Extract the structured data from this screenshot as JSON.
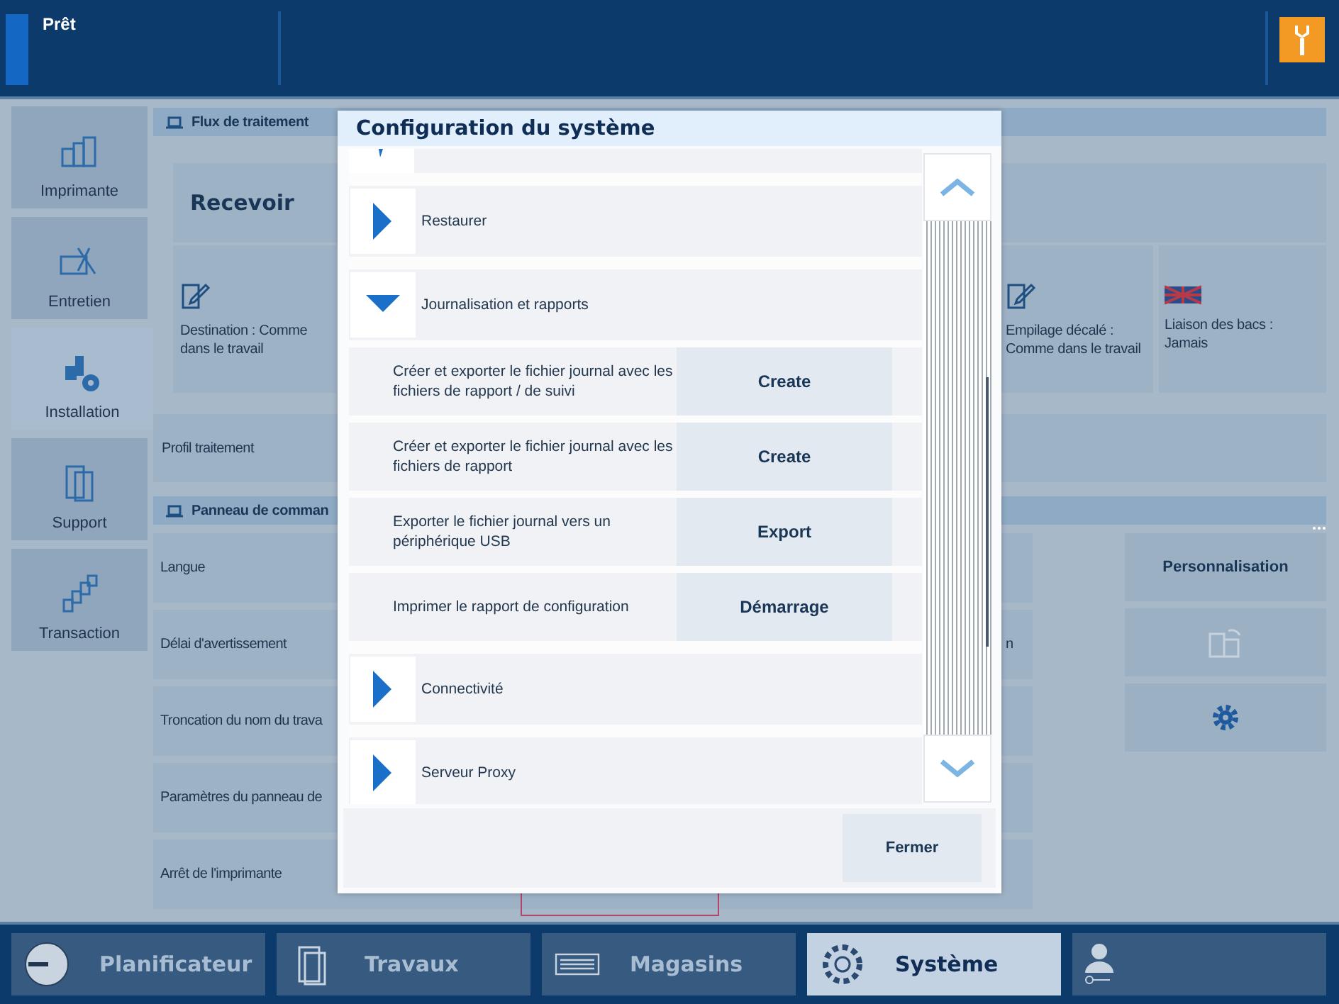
{
  "status_bar": {
    "text": "Prêt"
  },
  "sidebar": {
    "items": [
      {
        "label": "Imprimante",
        "kind": "printer",
        "selected": false
      },
      {
        "label": "Entretien",
        "kind": "tools",
        "selected": false
      },
      {
        "label": "Installation",
        "kind": "install",
        "selected": true
      },
      {
        "label": "Support",
        "kind": "support",
        "selected": false
      },
      {
        "label": "Transaction",
        "kind": "stairs",
        "selected": false
      }
    ]
  },
  "workflow": {
    "section_title": "Flux de traitement",
    "receive_title": "Recevoir",
    "settings": [
      {
        "label": "Destination : Comme dans le travail",
        "kind": "edit"
      },
      {
        "label": "Empilage décalé : Comme dans le travail",
        "kind": "edit"
      },
      {
        "label": "Liaison des bacs : Jamais",
        "kind": "link"
      }
    ],
    "profile_label": "Profil traitement"
  },
  "control_panel": {
    "section_title": "Panneau de comman",
    "rows": [
      {
        "label": "Langue"
      },
      {
        "label": "Délai d'avertissement",
        "fragment": "n"
      },
      {
        "label": "Troncation du nom du trava"
      },
      {
        "label": "Paramètres du panneau de"
      },
      {
        "label": "Arrêt de l'imprimante"
      }
    ],
    "buttons": [
      {
        "kind": "text",
        "label": "Personnalisation"
      },
      {
        "kind": "pages"
      },
      {
        "kind": "gear"
      }
    ]
  },
  "dialog": {
    "title": "Configuration du système",
    "items": [
      {
        "label": "Restaurer",
        "expanded": false
      },
      {
        "label": "Journalisation et rapports",
        "expanded": true,
        "children": [
          {
            "label": "Créer et exporter le fichier journal avec les fichiers de rapport / de suivi",
            "action": "Create"
          },
          {
            "label": "Créer et exporter le fichier journal avec les fichiers de rapport",
            "action": "Create"
          },
          {
            "label": "Exporter le fichier journal vers un périphérique USB",
            "action": "Export"
          },
          {
            "label": "Imprimer le rapport de configuration",
            "action": "Démarrage"
          }
        ]
      },
      {
        "label": "Connectivité",
        "expanded": false
      },
      {
        "label": "Serveur Proxy",
        "expanded": false
      }
    ],
    "close_label": "Fermer"
  },
  "bottom_nav": [
    {
      "label": "Planificateur",
      "kind": "clock",
      "selected": false
    },
    {
      "label": "Travaux",
      "kind": "doc",
      "selected": false
    },
    {
      "label": "Magasins",
      "kind": "tray",
      "selected": false
    },
    {
      "label": "Système",
      "kind": "gear",
      "selected": true
    },
    {
      "kind": "user",
      "selected": false
    }
  ]
}
